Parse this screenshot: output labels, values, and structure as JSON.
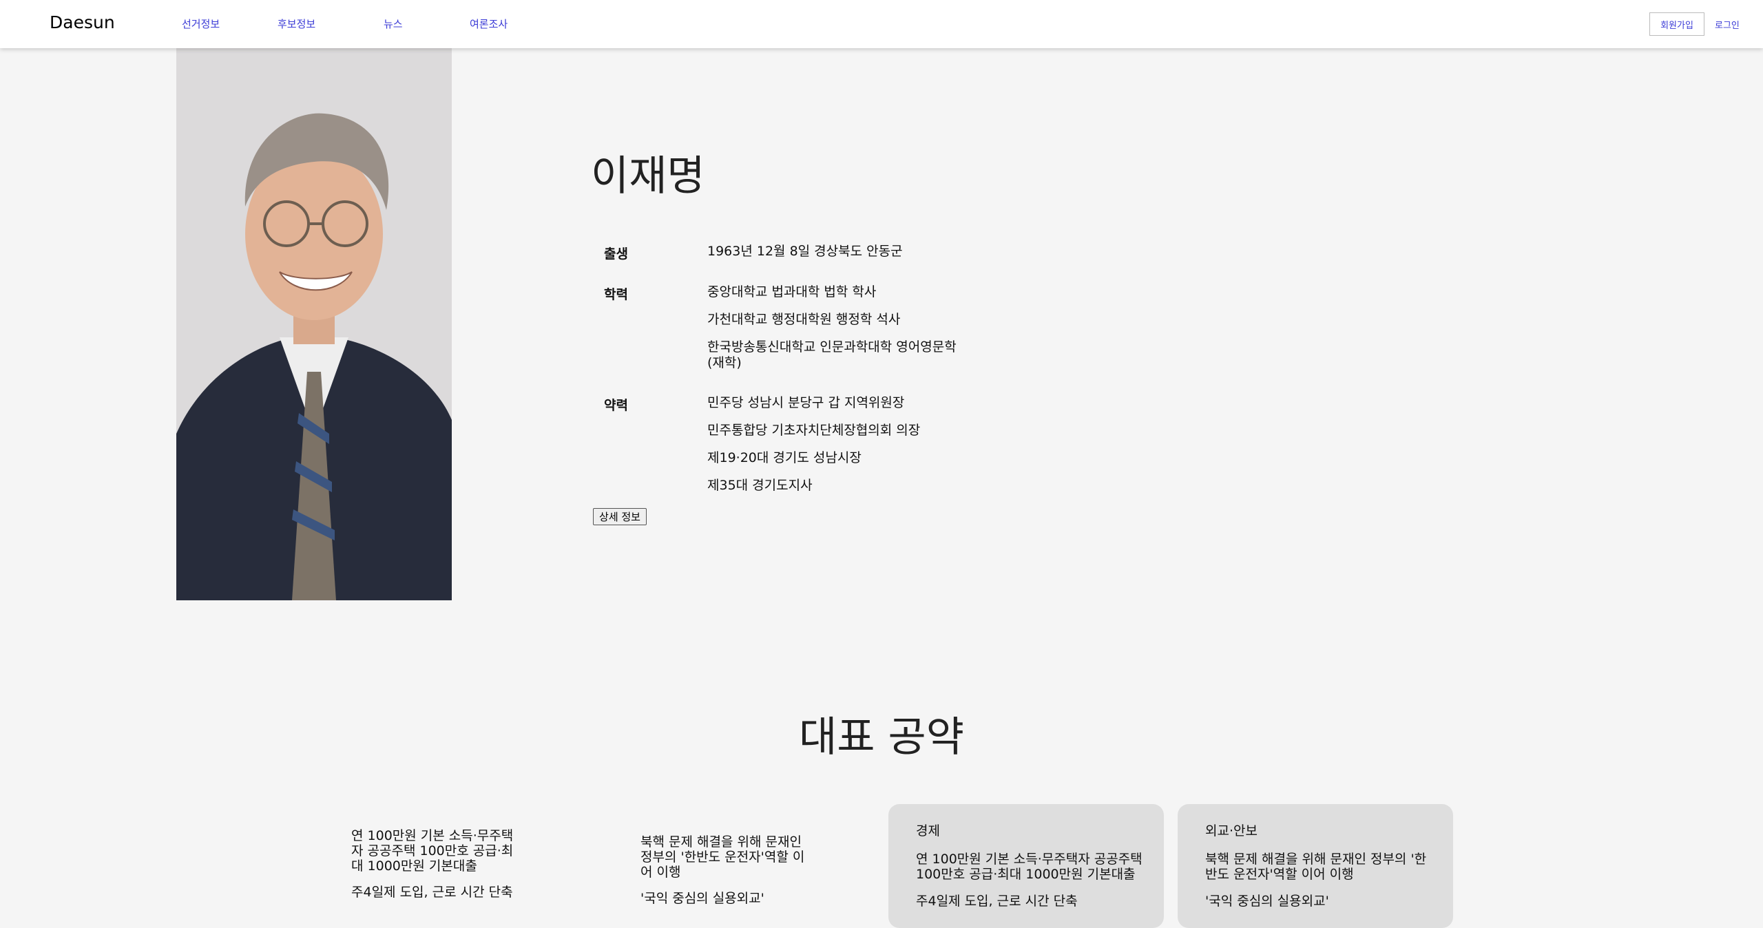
{
  "header": {
    "logo": "Daesun",
    "nav": [
      {
        "label": "선거정보"
      },
      {
        "label": "후보정보"
      },
      {
        "label": "뉴스"
      },
      {
        "label": "여론조사"
      }
    ],
    "signup_label": "회원가입",
    "login_label": "로그인"
  },
  "profile": {
    "name": "이재명",
    "birth_label": "출생",
    "birth_value": "1963년 12월 8일 경상북도 안동군",
    "education_label": "학력",
    "education": [
      "중앙대학교 법과대학 법학 학사",
      "가천대학교 행정대학원 행정학 석사",
      "한국방송통신대학교 인문과학대학 영어영문학 (재학)"
    ],
    "career_label": "약력",
    "career": [
      "민주당 성남시 분당구 갑 지역위원장",
      "민주통합당 기초자치단체장협의회 의장",
      "제19·20대 경기도 성남시장",
      "제35대 경기도지사"
    ],
    "detail_button": "상세 정보"
  },
  "pledges": {
    "title": "대표 공약",
    "col1": [
      "연 100만원 기본 소득·무주택자 공공주택 100만호 공급·최대 1000만원 기본대출",
      "주4일제 도입, 근로 시간 단축"
    ],
    "col2": [
      "북핵 문제 해결을 위해 문재인 정부의 '한반도 운전자'역할 이어 이행",
      "'국익 중심의 실용외교'"
    ],
    "cards": [
      {
        "title": "경제",
        "lines": [
          "연 100만원 기본 소득·무주택자 공공주택 100만호 공급·최대 1000만원 기본대출",
          "주4일제 도입, 근로 시간 단축"
        ]
      },
      {
        "title": "외교·안보",
        "lines": [
          "북핵 문제 해결을 위해 문재인 정부의 '한반도 운전자'역할 이어 이행",
          "'국익 중심의 실용외교'"
        ]
      }
    ]
  },
  "colors": {
    "link": "#3b3bd6",
    "page_bg": "#f5f5f5",
    "card_bg": "#dedede"
  }
}
